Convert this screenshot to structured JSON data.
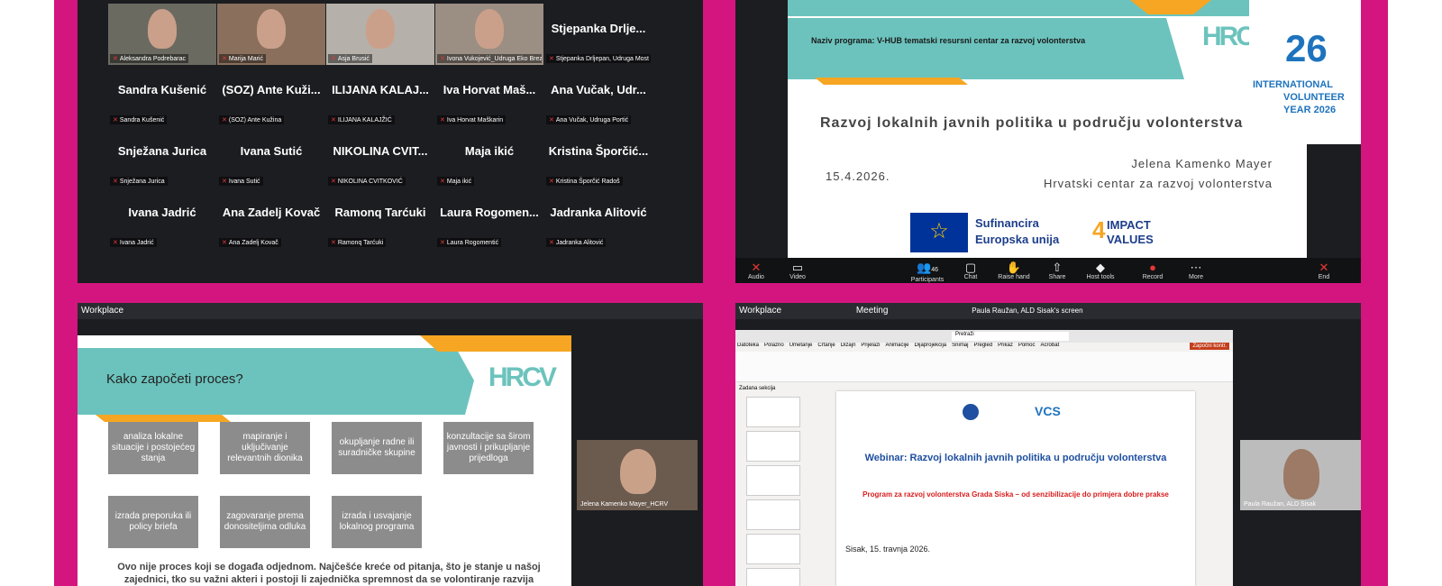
{
  "gallery": {
    "tiles": [
      {
        "name": "",
        "label": "Aleksandra Podrebarac",
        "video": true
      },
      {
        "name": "",
        "label": "Marija Marić",
        "video": true
      },
      {
        "name": "",
        "label": "Asja Brusić",
        "video": true
      },
      {
        "name": "",
        "label": "Ivona Vukojević_Udruga Eko Brez...",
        "video": true
      },
      {
        "name": "Stjepanka Drlje...",
        "label": "Stjepanka Drljepan, Udruga Most",
        "video": false
      },
      {
        "name": "Sandra Kušenić",
        "label": "Sandra Kušenić",
        "video": false
      },
      {
        "name": "(SOZ) Ante Kuži...",
        "label": "(SOZ) Ante Kužina",
        "video": false
      },
      {
        "name": "ILIJANA KALAJ...",
        "label": "ILIJANA KALAJŽIĆ",
        "video": false
      },
      {
        "name": "Iva Horvat Maš...",
        "label": "Iva Horvat Maškarin",
        "video": false
      },
      {
        "name": "Ana Vučak, Udr...",
        "label": "Ana Vučak, Udruga Portić",
        "video": false
      },
      {
        "name": "Snježana Jurica",
        "label": "Snježana Jurica",
        "video": false
      },
      {
        "name": "Ivana Sutić",
        "label": "Ivana Sutić",
        "video": false
      },
      {
        "name": "NIKOLINA CVIT...",
        "label": "NIKOLINA CVITKOVIĆ",
        "video": false
      },
      {
        "name": "Maja ikić",
        "label": "Maja ikić",
        "video": false
      },
      {
        "name": "Kristina Šporčić...",
        "label": "Kristina Šporčić Radoš",
        "video": false
      },
      {
        "name": "Ivana Jadrić",
        "label": "Ivana Jadrić",
        "video": false
      },
      {
        "name": "Ana Zadelj Kovač",
        "label": "Ana Zadelj Kovač",
        "video": false
      },
      {
        "name": "Ramonq Tarćuki",
        "label": "Ramonq Tarćuki",
        "video": false
      },
      {
        "name": "Laura Rogomen...",
        "label": "Laura Rogomentić",
        "video": false
      },
      {
        "name": "Jadranka Alitović",
        "label": "Jadranka Alitović",
        "video": false
      }
    ]
  },
  "title_slide": {
    "program": "Naziv programa: V-HUB tematski resursni centar za razvoj volonterstva",
    "title": "Razvoj lokalnih javnih politika u području volonterstva",
    "date": "15.4.2026.",
    "author": "Jelena Kamenko Mayer",
    "org": "Hrvatski centar za razvoj volonterstva",
    "eu_line1": "Sufinancira",
    "eu_line2": "Europska unija",
    "impact_num": "4",
    "impact_line1": "IMPACT",
    "impact_line2": "VALUES",
    "iyv_num": "26",
    "iyv_line1": "INTERNATIONAL",
    "iyv_line2": "VOLUNTEER",
    "iyv_line3": "YEAR 2026",
    "hrcv": "HRCV"
  },
  "zoom_toolbar": {
    "audio": "Audio",
    "video": "Video",
    "participants": "Participants",
    "participants_count": "46",
    "chat": "Chat",
    "raise": "Raise hand",
    "share": "Share",
    "host": "Host tools",
    "record": "Record",
    "more": "More",
    "end": "End"
  },
  "process_slide": {
    "window": "Workplace",
    "heading": "Kako započeti proces?",
    "steps": [
      "analiza lokalne situacije i postojećeg stanja",
      "mapiranje i uključivanje relevantnih dionika",
      "okupljanje radne ili suradničke skupine",
      "konzultacije sa širom javnosti i prikupljanje prijedloga",
      "izrada preporuka ili policy briefa",
      "zagovaranje prema donositeljima odluka",
      "izrada i usvajanje lokalnog programa"
    ],
    "footer": "Ovo nije proces koji se događa odjednom. Najčešće kreće od pitanja, što je stanje u našoj zajednici, tko su važni akteri i postoji li zajednička spremnost da se volontiranje razvija",
    "self_label": "Jelena Kamenko Mayer_HCRV"
  },
  "ppt": {
    "window": "Workplace",
    "meeting": "Meeting",
    "share_label": "Paula Raužan, ALD Sisak's screen",
    "menu": [
      "Datoteka",
      "Polazno",
      "Umetanje",
      "Crtanje",
      "Dizajn",
      "Prijelazi",
      "Animacije",
      "Dijaprojekcija",
      "Snimaj",
      "Pregled",
      "Prikaz",
      "Pomoć",
      "Acrobat"
    ],
    "search": "Pretraži",
    "start_btn": "Započni kontr.",
    "title": "Webinar: Razvoj lokalnih javnih politika u području volonterstva",
    "subtitle": "Program za razvoj volonterstva Grada Siska – od senzibilizacije do primjera dobre prakse",
    "date": "Sisak, 15. travnja 2026.",
    "section": "Zadana sekcija",
    "logo_text": "VCS",
    "self_label": "Paula Raužan, ALD Sisak"
  },
  "colors": {
    "frame": "#d4157f",
    "teal": "#6cc3bd",
    "orange": "#f6a623",
    "dark": "#1c1d21",
    "iyv_blue": "#1e73be"
  }
}
